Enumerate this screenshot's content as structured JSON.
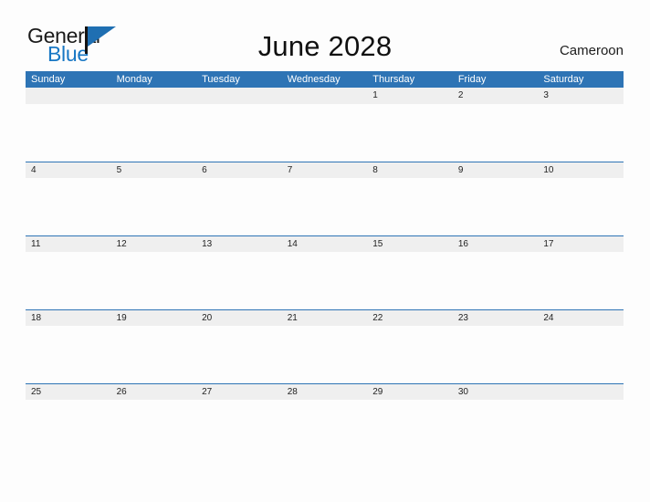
{
  "brand": {
    "name_part1": "General",
    "name_part2": "Blue",
    "flag_icon": "triangle-flag-icon",
    "accent_color": "#1f6fb2"
  },
  "header": {
    "title": "June 2028",
    "country": "Cameroon"
  },
  "calendar": {
    "month": "June",
    "year": "2028",
    "header_bg_color": "#2e74b5",
    "date_band_color": "#efefef",
    "weekdays": [
      "Sunday",
      "Monday",
      "Tuesday",
      "Wednesday",
      "Thursday",
      "Friday",
      "Saturday"
    ],
    "weeks": [
      {
        "days": [
          "",
          "",
          "",
          "",
          "1",
          "2",
          "3"
        ]
      },
      {
        "days": [
          "4",
          "5",
          "6",
          "7",
          "8",
          "9",
          "10"
        ]
      },
      {
        "days": [
          "11",
          "12",
          "13",
          "14",
          "15",
          "16",
          "17"
        ]
      },
      {
        "days": [
          "18",
          "19",
          "20",
          "21",
          "22",
          "23",
          "24"
        ]
      },
      {
        "days": [
          "25",
          "26",
          "27",
          "28",
          "29",
          "30",
          ""
        ]
      }
    ]
  }
}
